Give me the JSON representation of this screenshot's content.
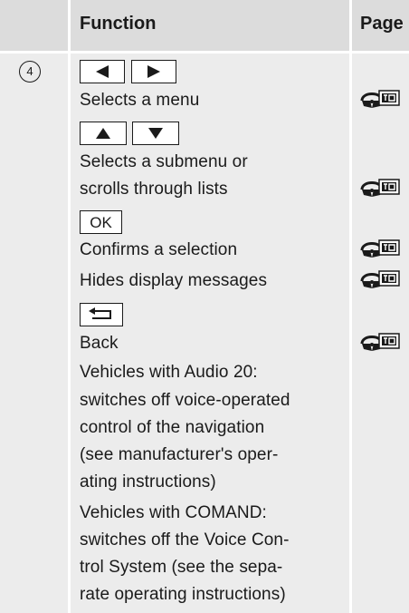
{
  "header": {
    "function": "Function",
    "page": "Page"
  },
  "row": {
    "number": "4",
    "ok_key": "OK",
    "lines": {
      "selects_menu": "Selects a menu",
      "selects_submenu_1": "Selects a submenu or",
      "selects_submenu_2": "scrolls through lists",
      "confirms": "Confirms a selection",
      "hides": "Hides display messages",
      "back": "Back",
      "audio_1": "Vehicles with Audio 20:",
      "audio_2": "switches off voice-operated",
      "audio_3": "control of the navigation",
      "audio_4": "(see manufacturer's oper-",
      "audio_5": "ating instructions)",
      "comand_1": "Vehicles with COMAND:",
      "comand_2": "switches off the Voice Con-",
      "comand_3": "trol System (see the sepa-",
      "comand_4": "rate operating instructions)"
    }
  },
  "icons": {
    "left_key": "left-arrow-icon",
    "right_key": "right-arrow-icon",
    "up_key": "up-arrow-icon",
    "down_key": "down-arrow-icon",
    "back_key": "back-arrow-icon",
    "page_ref": "steering-wheel-display-icon"
  }
}
